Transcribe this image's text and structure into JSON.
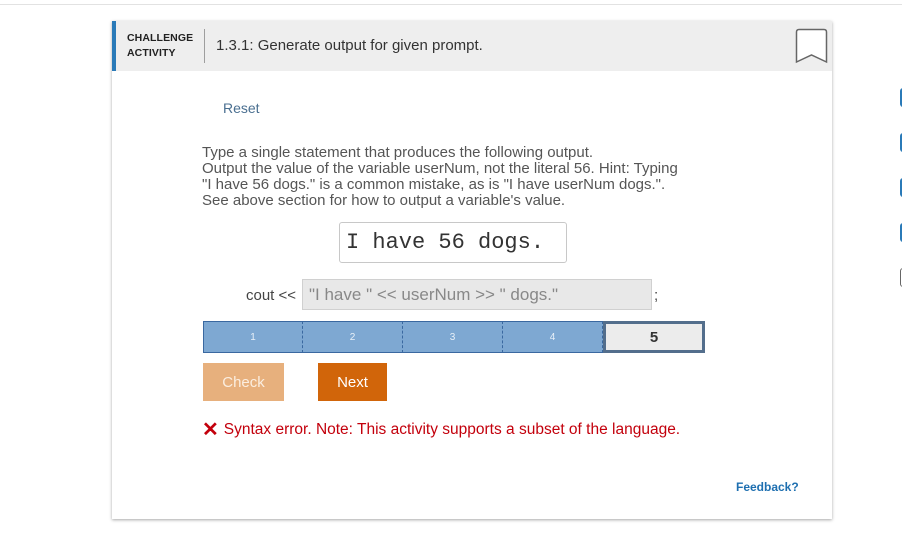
{
  "header": {
    "activity_label": "CHALLENGE ACTIVITY",
    "title": "1.3.1: Generate output for given prompt."
  },
  "reset_label": "Reset",
  "prompt": {
    "line1": "Type a single statement that produces the following output.",
    "line2": "Output the value of the variable userNum, not the literal 56. Hint: Typing",
    "line3": "\"I have 56 dogs.\" is a common mistake, as is \"I have userNum dogs.\".",
    "line4": "See above section for how to output a variable's value."
  },
  "expected_output": "I have 56 dogs.",
  "code": {
    "prefix": "cout <<",
    "value": "\"I have \" << userNum >> \" dogs.\"",
    "suffix": ";"
  },
  "levels": {
    "items": [
      "1",
      "2",
      "3",
      "4",
      "5"
    ],
    "current": 5
  },
  "buttons": {
    "check_label": "Check",
    "next_label": "Next"
  },
  "error": {
    "icon": "x-icon",
    "message": "Syntax error. Note: This activity supports a subset of the language."
  },
  "feedback_label": "Feedback?",
  "progress": {
    "items": [
      {
        "label": "1",
        "completed": true
      },
      {
        "label": "2",
        "completed": true
      },
      {
        "label": "3",
        "completed": true
      },
      {
        "label": "4",
        "completed": true
      },
      {
        "label": "5",
        "completed": false
      }
    ]
  },
  "colors": {
    "accent": "#2a7ab8",
    "check_button": "#e7b07d",
    "next_button": "#d1650a",
    "error": "#c3000c",
    "level_bar": "#7ea8d2"
  }
}
